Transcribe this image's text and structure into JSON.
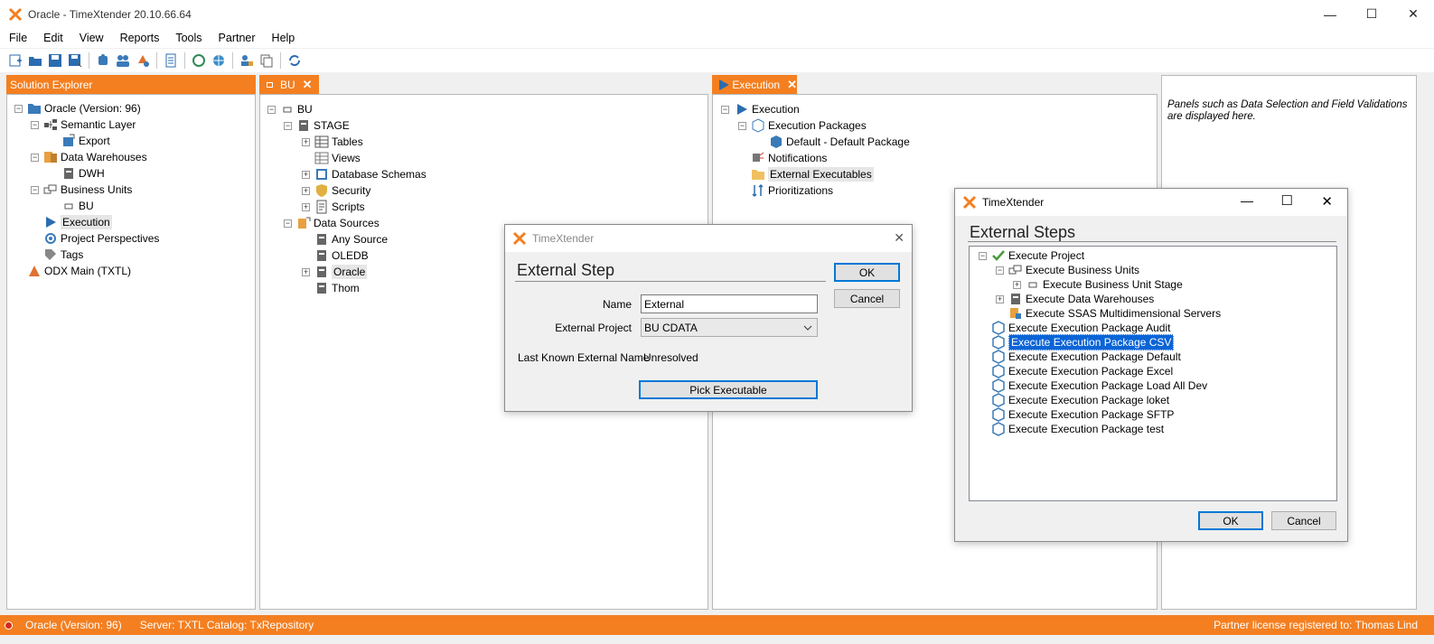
{
  "window": {
    "title": "Oracle - TimeXtender 20.10.66.64"
  },
  "menu": [
    "File",
    "Edit",
    "View",
    "Reports",
    "Tools",
    "Partner",
    "Help"
  ],
  "solution_explorer": {
    "header": "Solution Explorer",
    "items": [
      "Oracle (Version: 96)",
      "Semantic Layer",
      "Export",
      "Data Warehouses",
      "DWH",
      "Business Units",
      "BU",
      "Execution",
      "Project Perspectives",
      "Tags",
      "ODX Main (TXTL)"
    ]
  },
  "bu_panel": {
    "tab": "BU",
    "items": [
      "BU",
      "STAGE",
      "Tables",
      "Views",
      "Database Schemas",
      "Security",
      "Scripts",
      "Data Sources",
      "Any Source",
      "OLEDB",
      "Oracle",
      "Thom"
    ]
  },
  "execution_panel": {
    "tab": "Execution",
    "items": [
      "Execution",
      "Execution Packages",
      "Default - Default Package",
      "Notifications",
      "External Executables",
      "Prioritizations"
    ]
  },
  "info_panel": {
    "text": "Panels such as Data Selection and Field Validations are displayed here."
  },
  "external_step_dialog": {
    "title": "TimeXtender",
    "heading": "External Step",
    "name_label": "Name",
    "name_value": "External",
    "project_label": "External Project",
    "project_value": "BU CDATA",
    "last_known_label": "Last Known External Name",
    "last_known_value": "Unresolved",
    "pick_button": "Pick Executable",
    "ok": "OK",
    "cancel": "Cancel"
  },
  "external_steps_dialog": {
    "title": "TimeXtender",
    "heading": "External Steps",
    "items": [
      "Execute Project",
      "Execute Business Units",
      "Execute Business Unit Stage",
      "Execute Data Warehouses",
      "Execute SSAS Multidimensional Servers",
      "Execute Execution Package Audit",
      "Execute Execution Package CSV",
      "Execute Execution Package Default",
      "Execute Execution Package Excel",
      "Execute Execution Package Load All Dev",
      "Execute Execution Package loket",
      "Execute Execution Package SFTP",
      "Execute Execution Package test"
    ],
    "selected": "Execute Execution Package CSV",
    "ok": "OK",
    "cancel": "Cancel"
  },
  "statusbar": {
    "project": "Oracle (Version: 96)",
    "server": "Server: TXTL Catalog: TxRepository",
    "license": "Partner license registered to: Thomas Lind"
  },
  "colors": {
    "accent": "#f47f20",
    "selection": "#0a64d6"
  }
}
